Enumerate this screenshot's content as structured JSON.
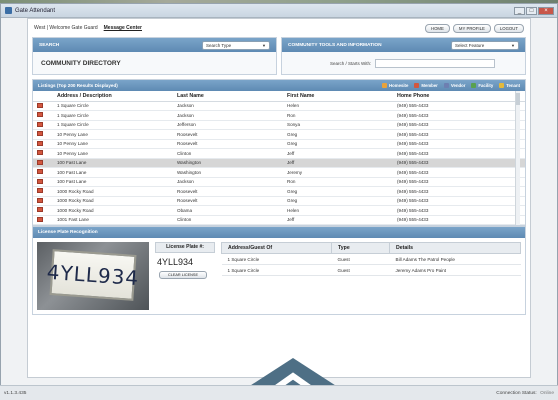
{
  "window": {
    "title": "Gate Attendant",
    "controls": [
      "_",
      "□",
      "×"
    ]
  },
  "header": {
    "welcome": "West | Welcome Gate Guard",
    "message_center": "Message Center",
    "buttons": [
      "HOME",
      "MY PROFILE",
      "LOGOUT"
    ]
  },
  "search_panel": {
    "title": "SEARCH",
    "select_value": "Search Type",
    "heading": "COMMUNITY DIRECTORY",
    "search_label": "Search / Starts With:",
    "search_value": ""
  },
  "community_panel": {
    "title": "COMMUNITY TOOLS AND INFORMATION",
    "select_value": "Select Feature"
  },
  "listings": {
    "header": "Listings (Top 200 Results Displayed)",
    "legend": [
      {
        "label": "Homesite",
        "color": "#e8a23a"
      },
      {
        "label": "Member",
        "color": "#d3573f"
      },
      {
        "label": "Vendor",
        "color": "#6d7fb1"
      },
      {
        "label": "Facility",
        "color": "#59a14f"
      },
      {
        "label": "Tenant",
        "color": "#e3b93b"
      }
    ],
    "columns": [
      "Address / Description",
      "Last Name",
      "First Name",
      "Home Phone"
    ],
    "rows": [
      [
        "1 Square Circle",
        "Jackson",
        "Helen",
        "(949) 555-4433"
      ],
      [
        "1 Square Circle",
        "Jackson",
        "Ron",
        "(949) 555-4433"
      ],
      [
        "1 Square Circle",
        "Jefferson",
        "Sonya",
        "(949) 555-4433"
      ],
      [
        "10 Penny Lane",
        "Roosevelt",
        "Greg",
        "(949) 555-4433"
      ],
      [
        "10 Penny Lane",
        "Roosevelt",
        "Greg",
        "(949) 555-4433"
      ],
      [
        "10 Penny Lane",
        "Clinton",
        "Jeff",
        "(949) 555-4433"
      ],
      [
        "100 Fast Lane",
        "Washington",
        "Jeff",
        "(949) 555-4433"
      ],
      [
        "100 Fast Lane",
        "Washington",
        "Jeremy",
        "(949) 555-4433"
      ],
      [
        "100 Fast Lane",
        "Jackson",
        "Ron",
        "(949) 555-4433"
      ],
      [
        "1000 Rocky Road",
        "Roosevelt",
        "Greg",
        "(949) 555-4433"
      ],
      [
        "1000 Rocky Road",
        "Roosevelt",
        "Greg",
        "(949) 555-4433"
      ],
      [
        "1000 Rocky Road",
        "Obama",
        "Helen",
        "(949) 555-4433"
      ],
      [
        "1001 Fast Lane",
        "Clinton",
        "Jeff",
        "(949) 555-4433"
      ]
    ],
    "selected_index": 6
  },
  "lpr": {
    "title": "License Plate Recognition",
    "plate_image_text": "4YLL934",
    "plate_label": "License Plate #:",
    "plate_value": "4YLL934",
    "clear_label": "CLEAR LICENSE",
    "columns": [
      "Address/Guest Of",
      "Type",
      "Details"
    ],
    "rows": [
      [
        "1 Square Circle",
        "Guest",
        "Bill Adams The Patrol People"
      ],
      [
        "1 Square Circle",
        "Guest",
        "Jeremy Adams Pro Paint"
      ]
    ]
  },
  "status": {
    "version": "v1.1.3.435",
    "connection_label": "Connection Status:",
    "connection_value": "Online"
  }
}
